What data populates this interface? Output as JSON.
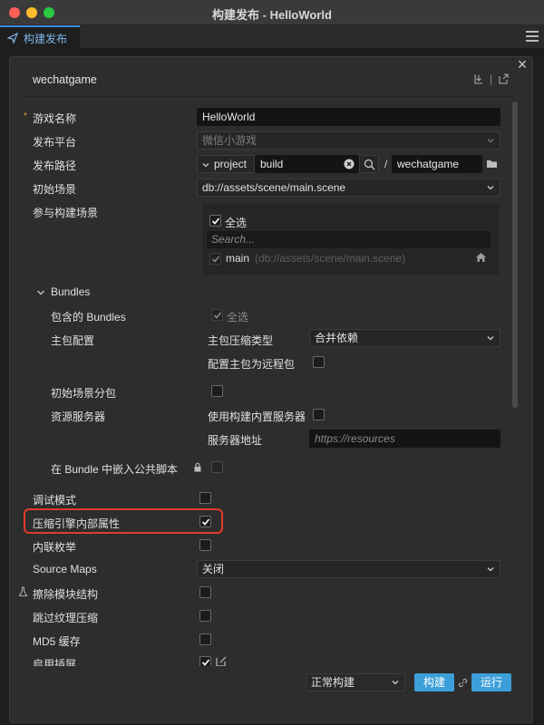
{
  "window": {
    "title": "构建发布 - HelloWorld"
  },
  "tab": {
    "label": "构建发布"
  },
  "panel": {
    "platform": "wechatgame",
    "header_separator": "|"
  },
  "form": {
    "game_name": {
      "label": "游戏名称",
      "value": "HelloWorld",
      "required_mark": "*"
    },
    "platform": {
      "label": "发布平台",
      "value": "微信小游戏"
    },
    "build_path": {
      "label": "发布路径",
      "prefix": "project",
      "value": "build",
      "separator": "/",
      "dest": "wechatgame"
    },
    "start_scene": {
      "label": "初始场景",
      "value": "db://assets/scene/main.scene"
    },
    "scenes": {
      "label": "参与构建场景",
      "select_all": "全选",
      "search_placeholder": "Search...",
      "items": [
        {
          "name": "main",
          "path": "(db://assets/scene/main.scene)",
          "checked": true
        }
      ]
    },
    "bundles": {
      "label": "Bundles",
      "included": {
        "label": "包含的 Bundles",
        "select_all": "全选"
      },
      "main_config": {
        "label": "主包配置",
        "compress_type_label": "主包压缩类型",
        "compress_type_value": "合并依赖",
        "remote_label": "配置主包为远程包"
      },
      "start_scene_subpackage": {
        "label": "初始场景分包"
      },
      "resource_server": {
        "label": "资源服务器",
        "builtin_label": "使用构建内置服务器",
        "addr_label": "服务器地址",
        "addr_placeholder": "https://resources"
      },
      "embed_common": {
        "label": "在 Bundle 中嵌入公共脚本"
      }
    },
    "debug": {
      "label": "调试模式"
    },
    "mangle": {
      "label": "压缩引擎内部属性"
    },
    "inline_enum": {
      "label": "内联枚举"
    },
    "source_maps": {
      "label": "Source Maps",
      "value": "关闭"
    },
    "erase_module": {
      "label": "擦除模块结构"
    },
    "skip_texture": {
      "label": "跳过纹理压缩"
    },
    "md5": {
      "label": "MD5 缓存"
    },
    "splash": {
      "label": "启用插屏"
    }
  },
  "footer": {
    "build_mode": "正常构建",
    "build_label": "构建",
    "run_label": "运行"
  },
  "colors": {
    "accent": "#3c9fd9",
    "highlight": "#e43a2a",
    "required": "#e7a23c"
  }
}
